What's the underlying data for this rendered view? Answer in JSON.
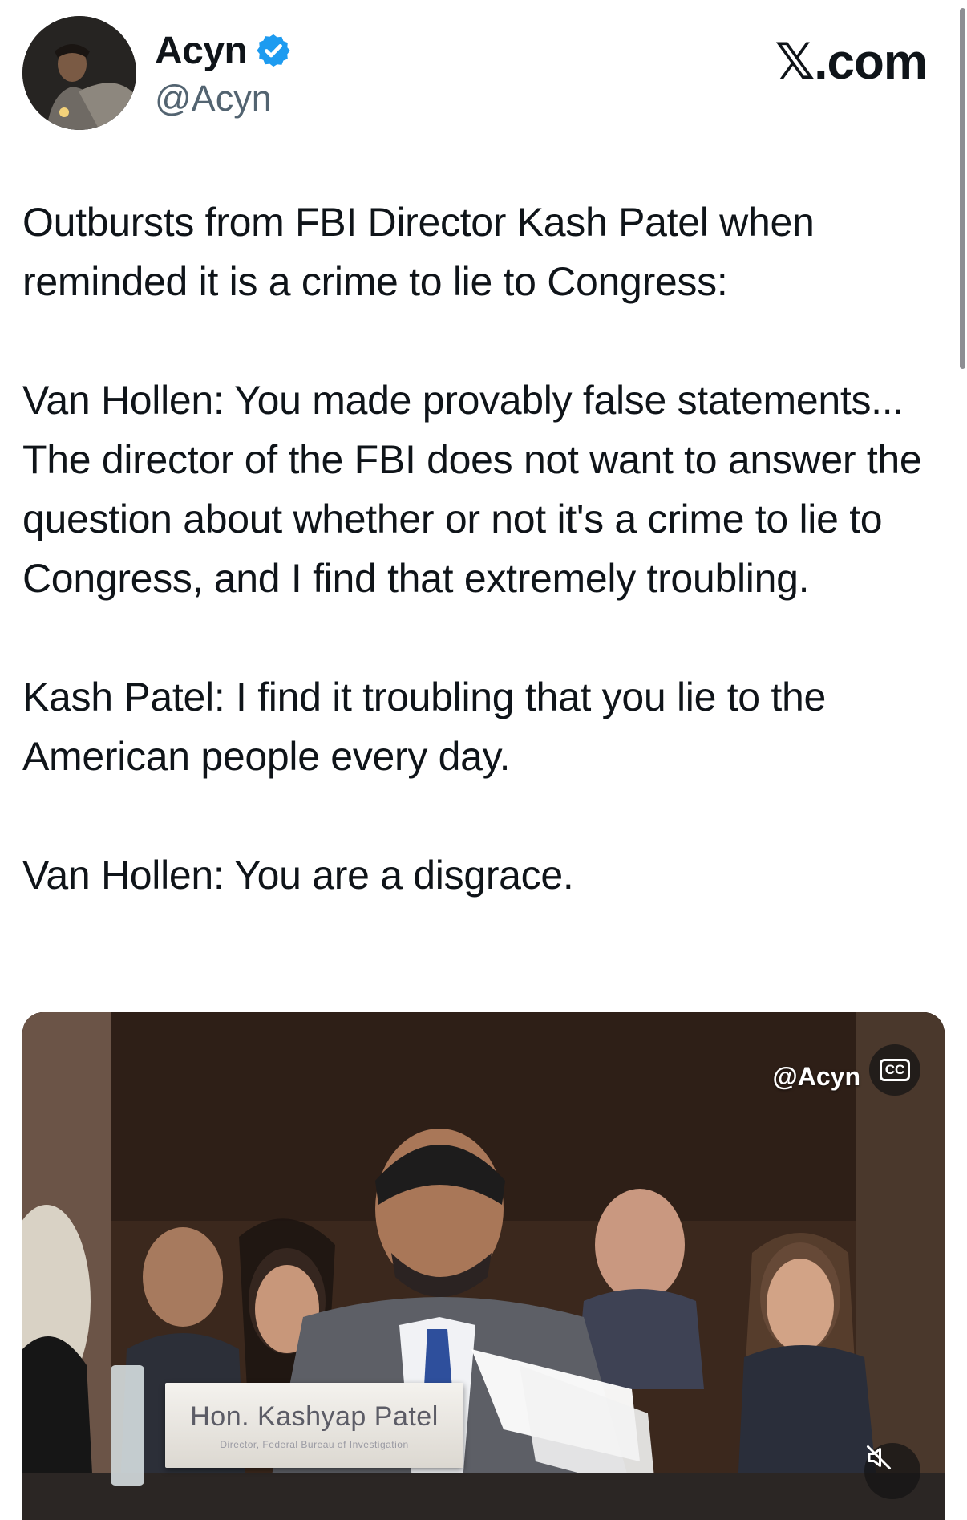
{
  "header": {
    "display_name": "Acyn",
    "handle": "@Acyn",
    "site_label": "𝕏.com",
    "verified_color": "#1d9bf0",
    "icons": {
      "verified": "verified-badge-icon"
    }
  },
  "tweet": {
    "paragraphs": [
      "Outbursts from FBI Director Kash Patel when reminded it is a crime to lie to Congress:",
      "Van Hollen: You made provably false statements... The director of the FBI does not want to answer the question about whether or not it's a crime to lie to Congress, and I find that extremely troubling.",
      "Kash Patel: I find it troubling that you lie to the American people every day.",
      "Van Hollen: You are a disgrace."
    ]
  },
  "media": {
    "watermark": "@Acyn",
    "cc_label": "CC",
    "nameplate_name": "Hon. Kashyap Patel",
    "nameplate_title": "Director, Federal Bureau of Investigation",
    "icons": {
      "captions": "closed-captions-icon",
      "mute": "speaker-muted-icon"
    }
  }
}
